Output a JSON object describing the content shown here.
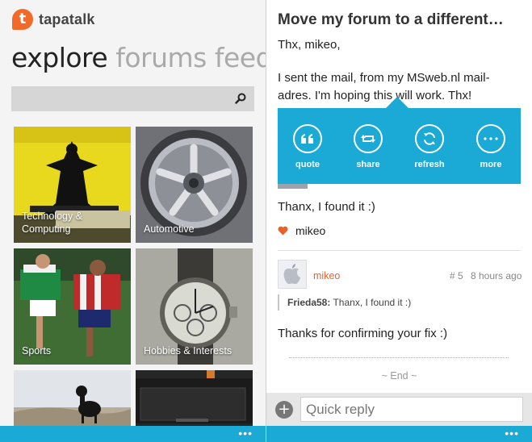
{
  "left": {
    "brand": {
      "logo_letter": "t",
      "name": "tapatalk",
      "accent": "#f26a2a"
    },
    "pivot": {
      "tabs": [
        "explore",
        "forums",
        "feed"
      ]
    },
    "search": {
      "placeholder": ""
    },
    "categories": [
      {
        "label": "Technology &\nComputing"
      },
      {
        "label": "Automotive"
      },
      {
        "label": "Sports"
      },
      {
        "label": "Hobbies & Interests"
      },
      {
        "label": ""
      },
      {
        "label": ""
      }
    ],
    "appbar": {
      "more": "•••"
    }
  },
  "right": {
    "thread_title": "Move my forum to a different…",
    "post1": {
      "greeting": "Thx, mikeo,",
      "body": "I sent the mail, from my MSweb.nl mail-adres. I'm hoping this will work. Thx!"
    },
    "popup": {
      "buttons": [
        {
          "label": "quote",
          "icon": "quote-icon"
        },
        {
          "label": "share",
          "icon": "retweet-icon"
        },
        {
          "label": "refresh",
          "icon": "refresh-icon"
        },
        {
          "label": "more",
          "icon": "more-icon"
        }
      ]
    },
    "post2": {
      "text": "Thanx, I found it :)",
      "liked_by": "mikeo"
    },
    "post3": {
      "author": "mikeo",
      "number": "# 5",
      "time": "8 hours ago",
      "quote_author": "Frieda58:",
      "quote_text": " Thanx, I found it :)",
      "text": "Thanks for confirming your fix :)"
    },
    "end_label": "~ End ~",
    "reply": {
      "placeholder": "Quick reply",
      "add": "+"
    },
    "appbar": {
      "more": "•••"
    }
  },
  "colors": {
    "accent_blue": "#1ba9d6",
    "author_orange": "#e8622c",
    "heart_orange": "#e8622c"
  }
}
